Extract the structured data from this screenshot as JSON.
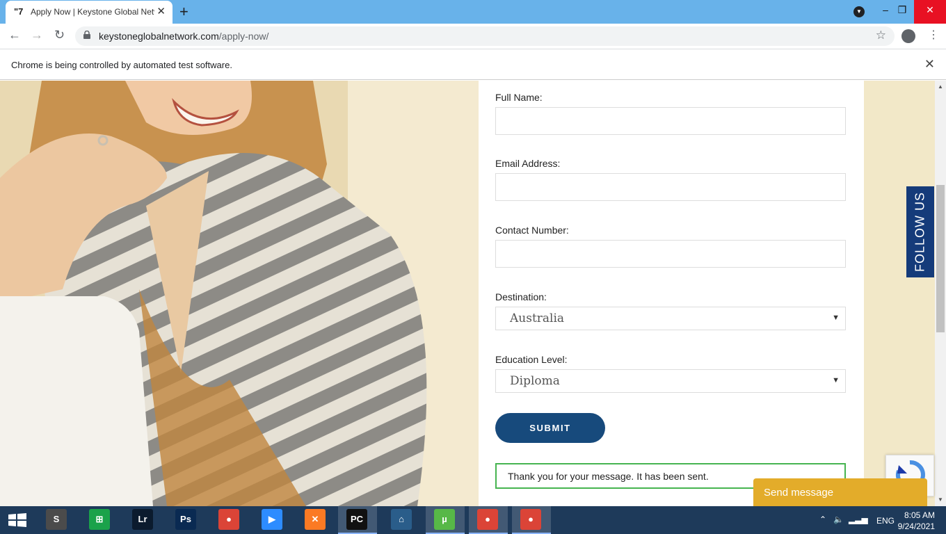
{
  "browser": {
    "tab_title": "Apply Now | Keystone Global Network",
    "tab_favicon": "\"7",
    "new_tab_glyph": "+",
    "close_tab_glyph": "✕",
    "url_domain": "keystoneglobalnetwork.com",
    "url_path": "/apply-now/",
    "infobar_message": "Chrome is being controlled by automated test software.",
    "window_controls": {
      "minimize": "–",
      "restore": "❐",
      "close": "✕"
    }
  },
  "form": {
    "full_name_label": "Full Name:",
    "full_name_value": "",
    "email_label": "Email Address:",
    "email_value": "",
    "contact_label": "Contact Number:",
    "contact_value": "",
    "destination_label": "Destination:",
    "destination_selected": "Australia",
    "education_label": "Education Level:",
    "education_selected": "Diploma",
    "submit_label": "SUBMIT",
    "success_message": "Thank you for your message. It has been sent."
  },
  "follow_us_label": "FOLLOW US",
  "send_message_label": "Send message",
  "taskbar": {
    "apps": [
      {
        "name": "sublime-text",
        "glyph": "S",
        "color": "#4b4b4b"
      },
      {
        "name": "store",
        "glyph": "⊞",
        "color": "#1aa24a"
      },
      {
        "name": "lightroom",
        "glyph": "Lr",
        "color": "#0b1b2e"
      },
      {
        "name": "photoshop",
        "glyph": "Ps",
        "color": "#0a2a52"
      },
      {
        "name": "chrome",
        "glyph": "●",
        "color": "#db4437"
      },
      {
        "name": "zoom",
        "glyph": "▶",
        "color": "#2d8cff"
      },
      {
        "name": "xampp",
        "glyph": "✕",
        "color": "#fb7a24"
      },
      {
        "name": "pycharm",
        "glyph": "PC",
        "color": "#111111"
      },
      {
        "name": "mysql-workbench",
        "glyph": "⌂",
        "color": "#2a5d8a"
      },
      {
        "name": "utorrent",
        "glyph": "µ",
        "color": "#57b847"
      },
      {
        "name": "chrome-2",
        "glyph": "●",
        "color": "#db4437"
      },
      {
        "name": "chrome-3",
        "glyph": "●",
        "color": "#db4437"
      }
    ],
    "language": "ENG",
    "time": "8:05 AM",
    "date": "9/24/2021"
  }
}
